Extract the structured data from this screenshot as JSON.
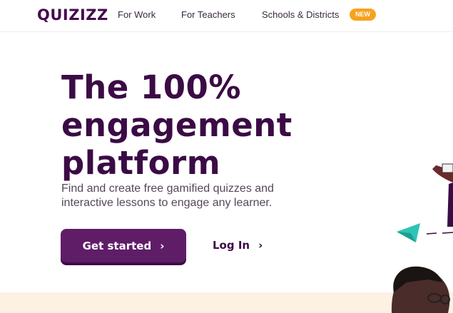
{
  "nav": {
    "logo": "QUIZIZZ",
    "links": [
      "For Work",
      "For Teachers",
      "Schools & Districts"
    ],
    "badge": "NEW"
  },
  "hero": {
    "headline": [
      "The 100%",
      "engagement",
      "platform"
    ],
    "subtext": [
      "Find and create free gamified quizzes and",
      "interactive lessons to engage any learner."
    ],
    "cta_primary": "Get started",
    "cta_secondary": "Log In"
  },
  "icons": [
    "chevron-right-icon",
    "paper-plane-icon"
  ],
  "colors": {
    "brand_purple": "#5f1d68",
    "headline": "#3b0b45",
    "badge": "#f7a21e",
    "plane": "#2ec4b6"
  }
}
